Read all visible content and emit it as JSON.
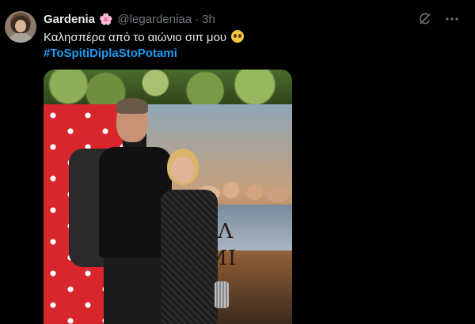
{
  "tweet": {
    "display_name": "Gardenia",
    "name_emoji": "🌸",
    "handle": "@legardeniaa",
    "separator": "·",
    "time": "3h",
    "text": "Καλησπέρα από το αιώνιο σιπ μου",
    "hashtag": "#ToSpitiDiplaStoPotami",
    "media": {
      "poster_title_line1": "Ι ΔΙΠΛ",
      "poster_title_line2": "ΟΤΑΜΙ"
    }
  },
  "icons": {
    "grok": "grok-icon",
    "more": "more-icon",
    "emoji": "pleading-face-emoji",
    "flower": "cherry-blossom-emoji"
  },
  "colors": {
    "background": "#000000",
    "text": "#e7e9ea",
    "muted": "#71767b",
    "link": "#1d9bf0"
  }
}
